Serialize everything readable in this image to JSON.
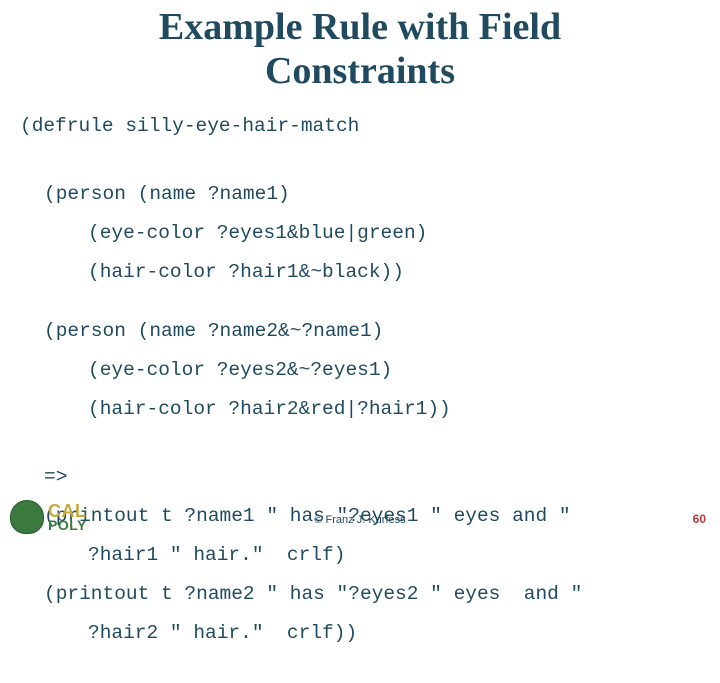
{
  "title_line1": "Example Rule with Field",
  "title_line2": "Constraints",
  "code": {
    "l1": "(defrule silly-eye-hair-match",
    "l2": "(person (name ?name1)",
    "l3": "(eye-color ?eyes1&blue|green)",
    "l4": "(hair-color ?hair1&~black))",
    "l5": "(person (name ?name2&~?name1)",
    "l6": "(eye-color ?eyes2&~?eyes1)",
    "l7": "(hair-color ?hair2&red|?hair1))",
    "l8": "=>",
    "l9": "(printout t ?name1 \" has \"?eyes1 \" eyes and \"",
    "l10": "?hair1 \" hair.\"  crlf)",
    "l11": "(printout t ?name2 \" has \"?eyes2 \" eyes  and \"",
    "l12": "?hair2 \" hair.\"  crlf))"
  },
  "logo": {
    "cal": "CAL",
    "poly": "POLY"
  },
  "copyright": "© Franz J. Kurfess",
  "page_number": "60"
}
